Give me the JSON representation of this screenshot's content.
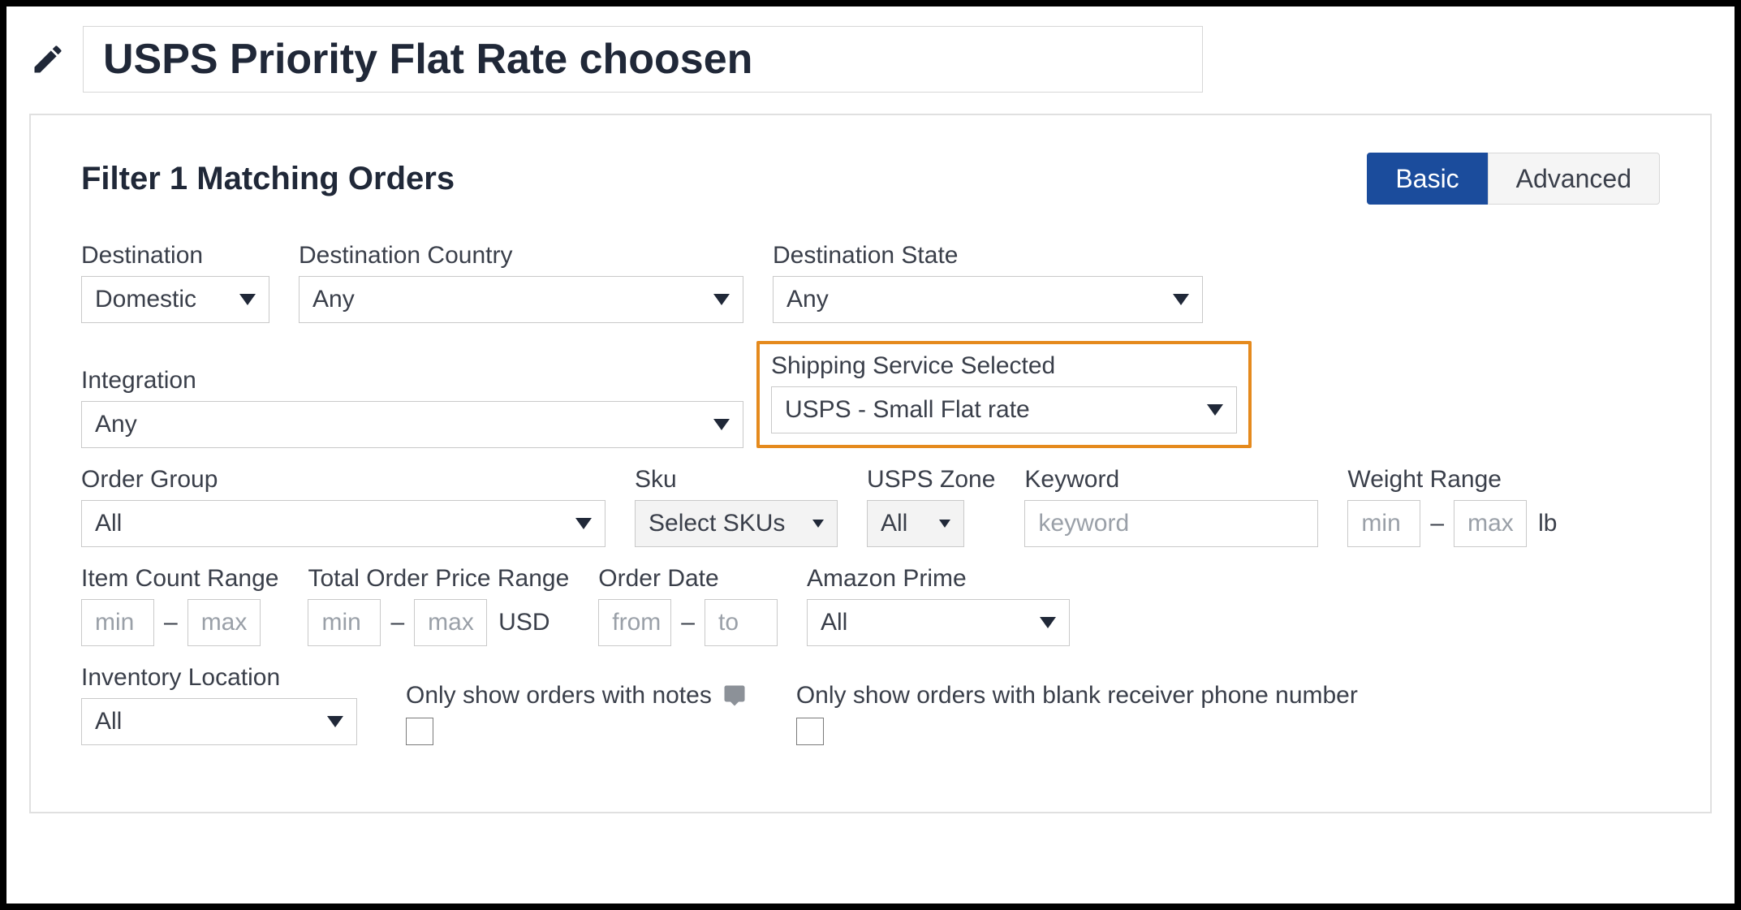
{
  "title": "USPS Priority Flat Rate choosen",
  "panel": {
    "heading": "Filter 1 Matching Orders",
    "toggle": {
      "basic": "Basic",
      "advanced": "Advanced"
    }
  },
  "fields": {
    "destination": {
      "label": "Destination",
      "value": "Domestic"
    },
    "destinationCountry": {
      "label": "Destination Country",
      "value": "Any"
    },
    "destinationState": {
      "label": "Destination State",
      "value": "Any"
    },
    "integration": {
      "label": "Integration",
      "value": "Any"
    },
    "shippingService": {
      "label": "Shipping Service Selected",
      "value": "USPS - Small Flat rate"
    },
    "orderGroup": {
      "label": "Order Group",
      "value": "All"
    },
    "sku": {
      "label": "Sku",
      "button": "Select SKUs"
    },
    "uspsZone": {
      "label": "USPS Zone",
      "button": "All"
    },
    "keyword": {
      "label": "Keyword",
      "placeholder": "keyword"
    },
    "weightRange": {
      "label": "Weight Range",
      "minPh": "min",
      "maxPh": "max",
      "unit": "lb"
    },
    "itemCountRange": {
      "label": "Item Count Range",
      "minPh": "min",
      "maxPh": "max"
    },
    "totalPriceRange": {
      "label": "Total Order Price Range",
      "minPh": "min",
      "maxPh": "max",
      "unit": "USD"
    },
    "orderDate": {
      "label": "Order Date",
      "fromPh": "from",
      "toPh": "to"
    },
    "amazonPrime": {
      "label": "Amazon Prime",
      "value": "All"
    },
    "inventoryLocation": {
      "label": "Inventory Location",
      "value": "All"
    },
    "onlyNotes": {
      "label": "Only show orders with notes"
    },
    "onlyBlankPhone": {
      "label": "Only show orders with blank receiver phone number"
    }
  }
}
